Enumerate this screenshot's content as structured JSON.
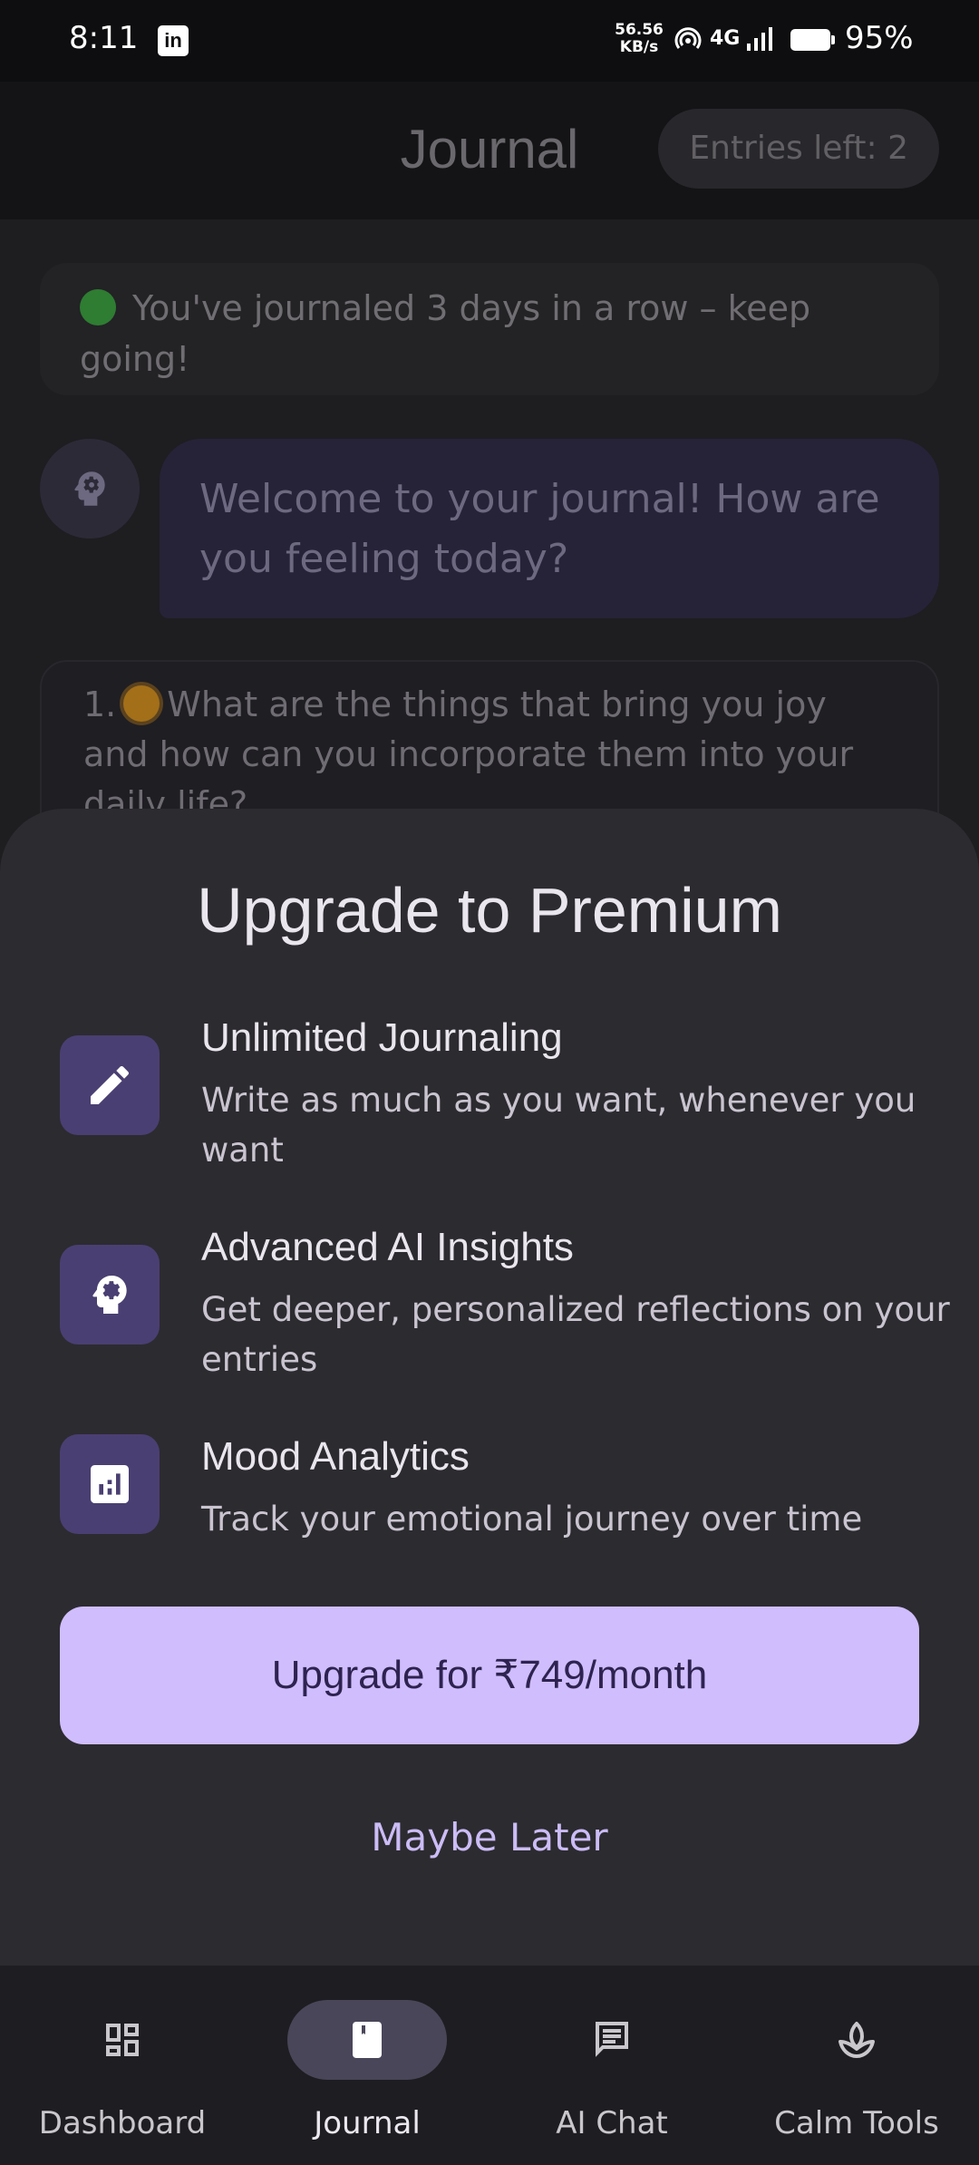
{
  "status_bar": {
    "time": "8:11",
    "speed_value": "56.56",
    "speed_unit": "KB/s",
    "network": "4G",
    "battery": "95%"
  },
  "header": {
    "title": "Journal",
    "entries_left": "Entries left: 2"
  },
  "content": {
    "streak": "You've journaled 3 days in a row – keep going!",
    "welcome_message": "Welcome to your journal! How are you feeling today?",
    "prompt_number": "1.",
    "prompt_text": "What are the things that bring you joy and how can you incorporate them into your daily life?"
  },
  "sheet": {
    "title": "Upgrade to Premium",
    "features": [
      {
        "icon": "pencil-icon",
        "title": "Unlimited Journaling",
        "description": "Write as much as you want, whenever you want"
      },
      {
        "icon": "brain-gear-icon",
        "title": "Advanced AI Insights",
        "description": "Get deeper, personalized reflections on your entries"
      },
      {
        "icon": "chart-icon",
        "title": "Mood Analytics",
        "description": "Track your emotional journey over time"
      }
    ],
    "upgrade_label": "Upgrade for ₹749/month",
    "later_label": "Maybe Later"
  },
  "nav": {
    "items": [
      {
        "label": "Dashboard",
        "icon": "dashboard-icon",
        "active": false
      },
      {
        "label": "Journal",
        "icon": "book-icon",
        "active": true
      },
      {
        "label": "AI Chat",
        "icon": "chat-icon",
        "active": false
      },
      {
        "label": "Calm Tools",
        "icon": "lotus-icon",
        "active": false
      }
    ]
  },
  "colors": {
    "accent": "#cfbdfd",
    "sheet_bg": "#2c2b30",
    "icon_tile": "#4a3f72"
  }
}
